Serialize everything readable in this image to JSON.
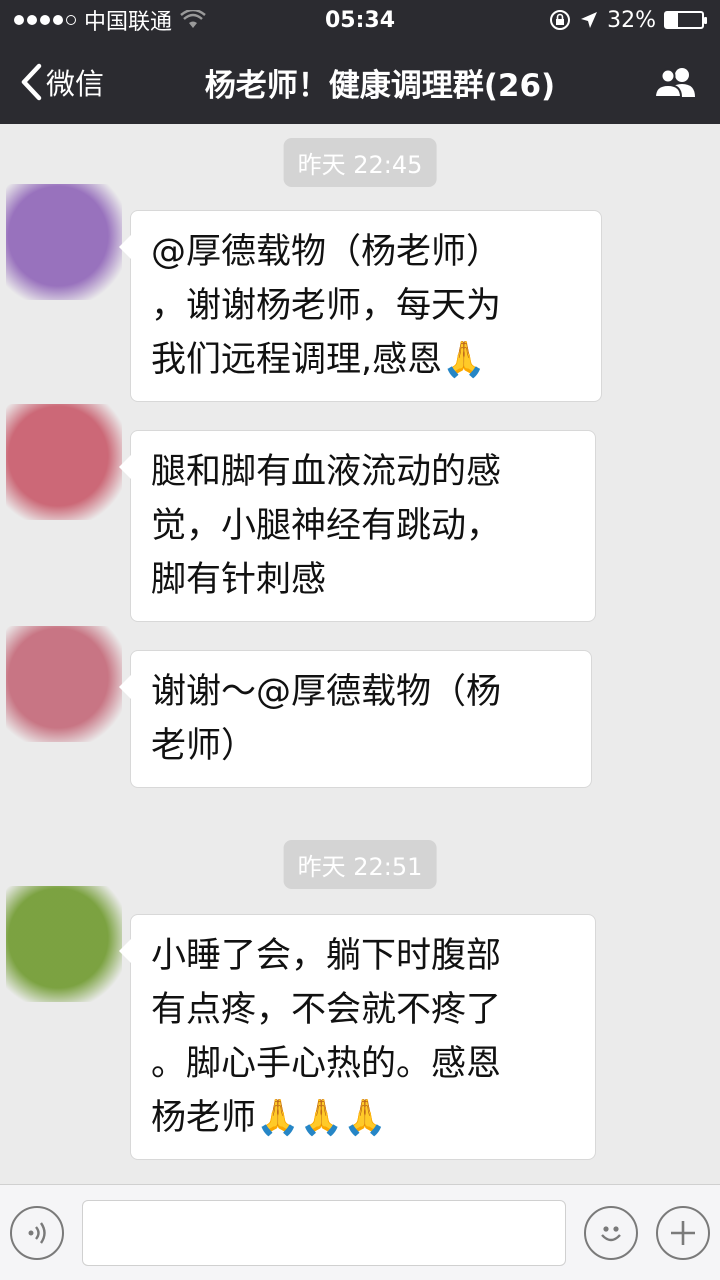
{
  "status_bar": {
    "carrier": "中国联通",
    "time": "05:34",
    "battery_percent": "32%",
    "battery_level": 0.32,
    "signal_bars_filled": 4,
    "signal_bars_total": 5
  },
  "nav": {
    "back_label": "微信",
    "title": "杨老师！健康调理群(26)",
    "group_icon": "group-members-icon"
  },
  "chat": {
    "timestamps": [
      "昨天 22:45",
      "昨天 22:51"
    ],
    "messages": [
      {
        "lines": [
          "@厚德载物（杨老师）",
          "，谢谢杨老师，每天为",
          "我们远程调理,感恩🙏"
        ],
        "avatar_color": "#8f64b8"
      },
      {
        "lines": [
          "腿和脚有血液流动的感",
          "觉，小腿神经有跳动，",
          "脚有针刺感"
        ],
        "avatar_color": "#c85a6a"
      },
      {
        "lines": [
          "谢谢～@厚德载物（杨",
          "老师）"
        ],
        "avatar_color": "#c46878"
      },
      {
        "lines": [
          "小睡了会，躺下时腹部",
          "有点疼，不会就不疼了",
          "。脚心手心热的。感恩",
          "杨老师🙏🙏🙏"
        ],
        "avatar_color": "#6f9a2e"
      }
    ]
  },
  "input_bar": {
    "voice_icon": "voice-icon",
    "emoji_icon": "emoji-icon",
    "plus_icon": "plus-icon",
    "input_value": ""
  }
}
